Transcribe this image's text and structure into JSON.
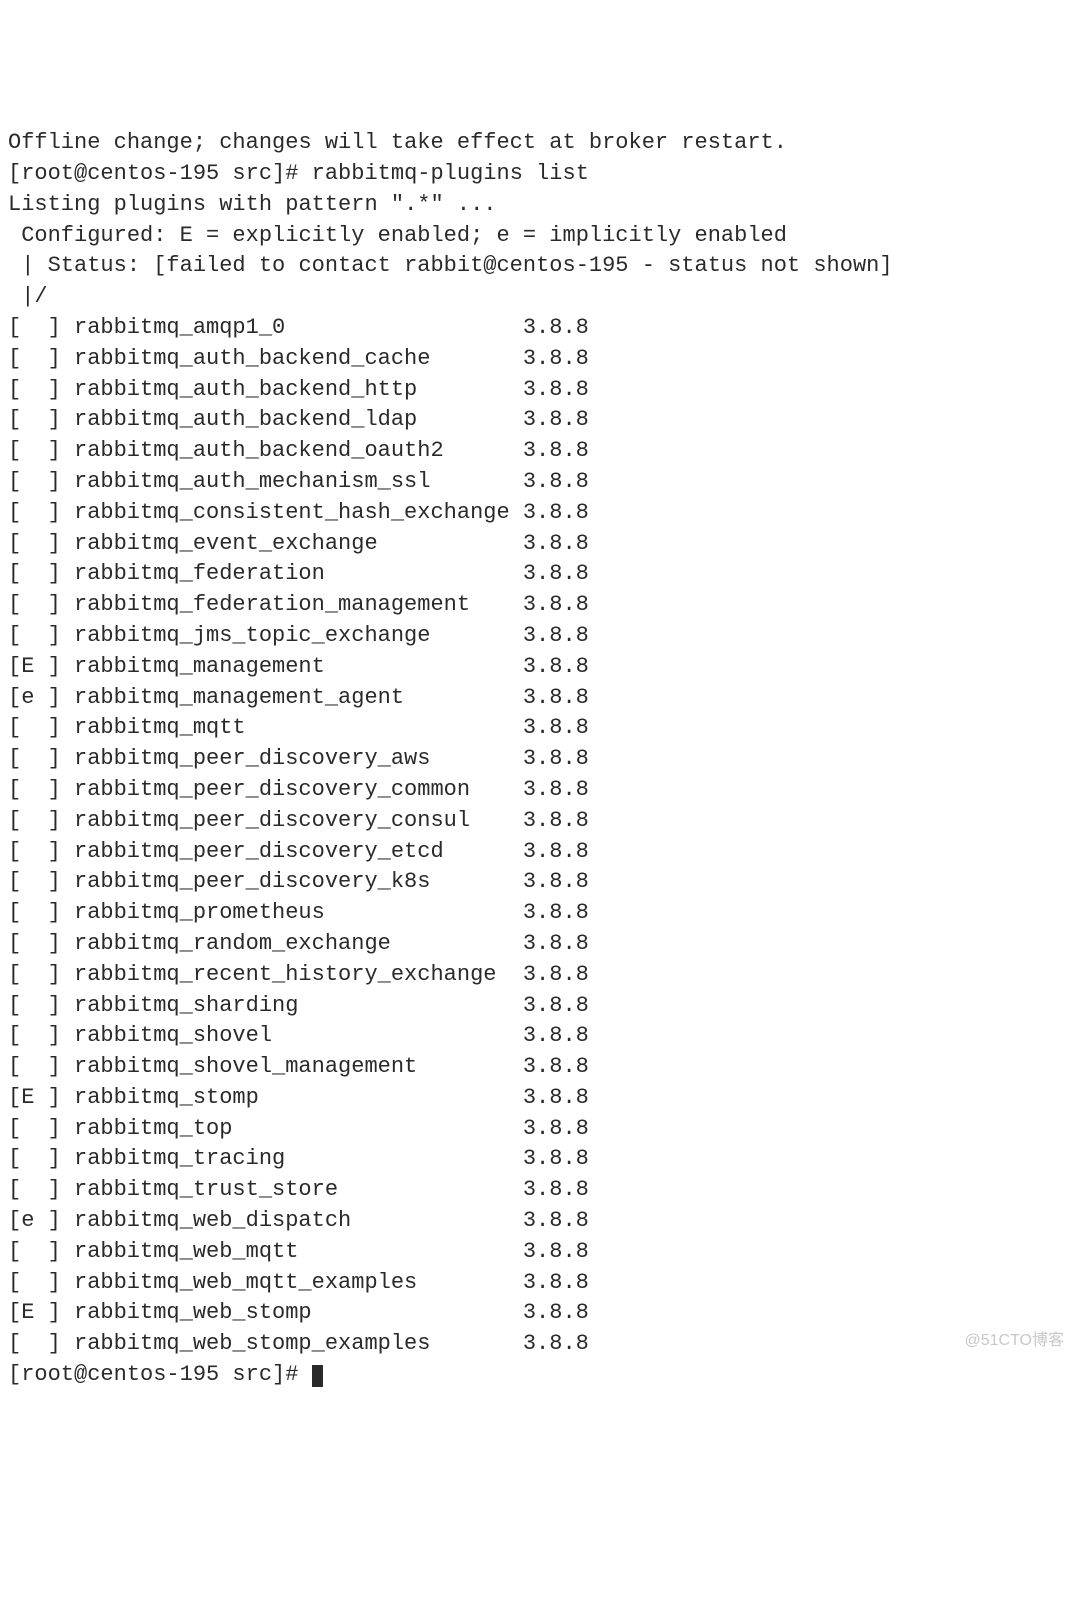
{
  "header": {
    "partial_line": "Offline change; changes will take effect at broker restart.",
    "prompt1": "[root@centos-195 src]# ",
    "command1": "rabbitmq-plugins list",
    "listing_line": "Listing plugins with pattern \".*\" ...",
    "configured_line": " Configured: E = explicitly enabled; e = implicitly enabled",
    "status_line": " | Status: [failed to contact rabbit@centos-195 - status not shown]",
    "tree_line": " |/"
  },
  "plugins": [
    {
      "status": "[  ]",
      "name": "rabbitmq_amqp1_0",
      "version": "3.8.8"
    },
    {
      "status": "[  ]",
      "name": "rabbitmq_auth_backend_cache",
      "version": "3.8.8"
    },
    {
      "status": "[  ]",
      "name": "rabbitmq_auth_backend_http",
      "version": "3.8.8"
    },
    {
      "status": "[  ]",
      "name": "rabbitmq_auth_backend_ldap",
      "version": "3.8.8"
    },
    {
      "status": "[  ]",
      "name": "rabbitmq_auth_backend_oauth2",
      "version": "3.8.8"
    },
    {
      "status": "[  ]",
      "name": "rabbitmq_auth_mechanism_ssl",
      "version": "3.8.8"
    },
    {
      "status": "[  ]",
      "name": "rabbitmq_consistent_hash_exchange",
      "version": "3.8.8"
    },
    {
      "status": "[  ]",
      "name": "rabbitmq_event_exchange",
      "version": "3.8.8"
    },
    {
      "status": "[  ]",
      "name": "rabbitmq_federation",
      "version": "3.8.8"
    },
    {
      "status": "[  ]",
      "name": "rabbitmq_federation_management",
      "version": "3.8.8"
    },
    {
      "status": "[  ]",
      "name": "rabbitmq_jms_topic_exchange",
      "version": "3.8.8"
    },
    {
      "status": "[E ]",
      "name": "rabbitmq_management",
      "version": "3.8.8"
    },
    {
      "status": "[e ]",
      "name": "rabbitmq_management_agent",
      "version": "3.8.8"
    },
    {
      "status": "[  ]",
      "name": "rabbitmq_mqtt",
      "version": "3.8.8"
    },
    {
      "status": "[  ]",
      "name": "rabbitmq_peer_discovery_aws",
      "version": "3.8.8"
    },
    {
      "status": "[  ]",
      "name": "rabbitmq_peer_discovery_common",
      "version": "3.8.8"
    },
    {
      "status": "[  ]",
      "name": "rabbitmq_peer_discovery_consul",
      "version": "3.8.8"
    },
    {
      "status": "[  ]",
      "name": "rabbitmq_peer_discovery_etcd",
      "version": "3.8.8"
    },
    {
      "status": "[  ]",
      "name": "rabbitmq_peer_discovery_k8s",
      "version": "3.8.8"
    },
    {
      "status": "[  ]",
      "name": "rabbitmq_prometheus",
      "version": "3.8.8"
    },
    {
      "status": "[  ]",
      "name": "rabbitmq_random_exchange",
      "version": "3.8.8"
    },
    {
      "status": "[  ]",
      "name": "rabbitmq_recent_history_exchange",
      "version": "3.8.8"
    },
    {
      "status": "[  ]",
      "name": "rabbitmq_sharding",
      "version": "3.8.8"
    },
    {
      "status": "[  ]",
      "name": "rabbitmq_shovel",
      "version": "3.8.8"
    },
    {
      "status": "[  ]",
      "name": "rabbitmq_shovel_management",
      "version": "3.8.8"
    },
    {
      "status": "[E ]",
      "name": "rabbitmq_stomp",
      "version": "3.8.8"
    },
    {
      "status": "[  ]",
      "name": "rabbitmq_top",
      "version": "3.8.8"
    },
    {
      "status": "[  ]",
      "name": "rabbitmq_tracing",
      "version": "3.8.8"
    },
    {
      "status": "[  ]",
      "name": "rabbitmq_trust_store",
      "version": "3.8.8"
    },
    {
      "status": "[e ]",
      "name": "rabbitmq_web_dispatch",
      "version": "3.8.8"
    },
    {
      "status": "[  ]",
      "name": "rabbitmq_web_mqtt",
      "version": "3.8.8"
    },
    {
      "status": "[  ]",
      "name": "rabbitmq_web_mqtt_examples",
      "version": "3.8.8"
    },
    {
      "status": "[E ]",
      "name": "rabbitmq_web_stomp",
      "version": "3.8.8"
    },
    {
      "status": "[  ]",
      "name": "rabbitmq_web_stomp_examples",
      "version": "3.8.8"
    }
  ],
  "footer": {
    "prompt2": "[root@centos-195 src]# "
  },
  "watermark": "@51CTO博客"
}
